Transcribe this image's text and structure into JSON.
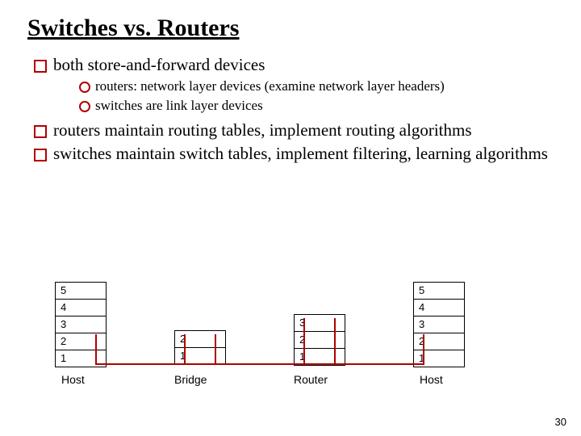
{
  "title": "Switches vs. Routers",
  "b1": "both store-and-forward devices",
  "b1a": "routers: network layer devices (examine network layer headers)",
  "b1b": "switches are link layer devices",
  "b2": "routers maintain routing tables, implement routing algorithms",
  "b3": "switches maintain switch tables, implement filtering, learning algorithms",
  "L5": "5",
  "L4": "4",
  "L3": "3",
  "L2": "2",
  "L1": "1",
  "host": "Host",
  "bridge": "Bridge",
  "router": "Router",
  "page": "30"
}
